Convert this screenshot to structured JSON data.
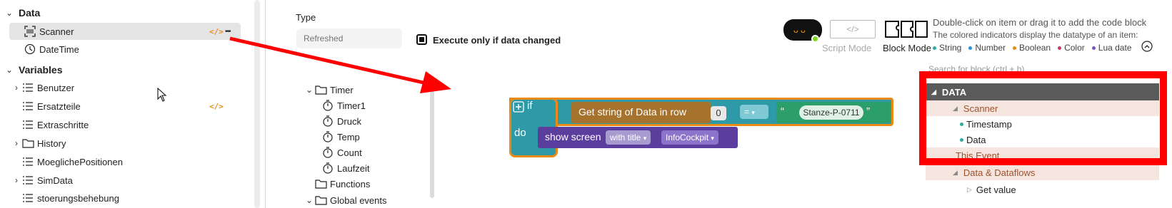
{
  "left_tree": {
    "sections": {
      "data": "Data",
      "variables": "Variables"
    },
    "data_items": [
      {
        "label": "Scanner"
      },
      {
        "label": "DateTime"
      }
    ],
    "variable_items": [
      {
        "label": "Benutzer"
      },
      {
        "label": "Ersatzteile"
      },
      {
        "label": "Extraschritte"
      },
      {
        "label": "History"
      },
      {
        "label": "MoeglichePositionen"
      },
      {
        "label": "SimData"
      },
      {
        "label": "stoerungsbehebung"
      }
    ],
    "code_glyph": "</>",
    "more_glyph": "•••"
  },
  "middle": {
    "type_label": "Type",
    "type_placeholder": "Refreshed",
    "execute_label": "Execute only if data changed",
    "tree": [
      {
        "label": "Timer"
      },
      {
        "label": "Timer1"
      },
      {
        "label": "Druck"
      },
      {
        "label": "Temp"
      },
      {
        "label": "Count"
      },
      {
        "label": "Laufzeit"
      },
      {
        "label": "Functions"
      },
      {
        "label": "Global events"
      }
    ]
  },
  "blocks": {
    "if_label": "if",
    "do_label": "do",
    "get_string": "Get string of Data in row",
    "row_value": "0",
    "op": "=",
    "op_arrow": "▾",
    "quote_open": "“",
    "quote_close": "”",
    "string_value": "Stanze-P-0711",
    "show_screen": "show screen",
    "with_title": "with title",
    "title_value": "InfoCockpit"
  },
  "right_header": {
    "script_mode": "Script Mode",
    "block_mode": "Block Mode",
    "code_glyph": "</>",
    "hint1": "Double-click on item or drag it to add the code block",
    "hint2": "The colored indicators display the datatype of an item:",
    "legend": [
      {
        "label": "String",
        "color": "#2eaaa0"
      },
      {
        "label": "Number",
        "color": "#2b8fd6"
      },
      {
        "label": "Boolean",
        "color": "#e58c1b"
      },
      {
        "label": "Color",
        "color": "#c0395e"
      },
      {
        "label": "Lua date",
        "color": "#7b53c1"
      }
    ]
  },
  "right_panel": {
    "search_placeholder": "Search for block (ctrl + b)",
    "data_header": "DATA",
    "scanner": "Scanner",
    "timestamp": "Timestamp",
    "data": "Data",
    "this_event": "This Event",
    "data_dataflows": "Data & Dataflows",
    "get_value": "Get value"
  },
  "colors": {
    "annotation_red": "#ff0000",
    "brand_orange": "#e58c1b",
    "panel_header": "#5a5a5a",
    "data_section_bar": "#a0512d"
  }
}
